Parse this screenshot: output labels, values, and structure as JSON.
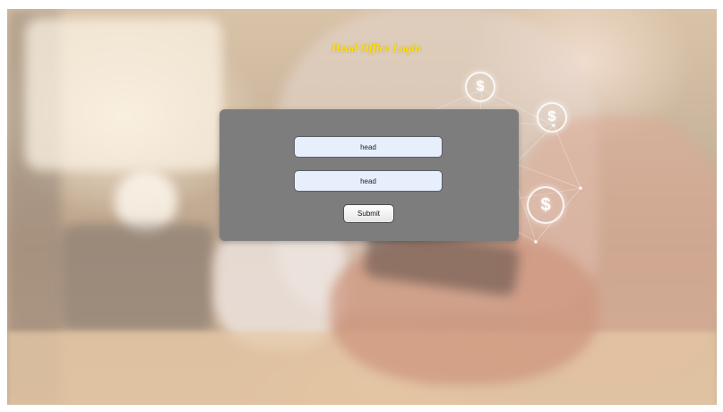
{
  "login": {
    "title": "Head Office Login",
    "username_value": "head",
    "password_value": "head",
    "submit_label": "Submit"
  },
  "decor": {
    "coin_symbol": "$",
    "title_color": "#ffe100",
    "panel_color": "#7d7d7d",
    "field_color": "#e8effc"
  }
}
